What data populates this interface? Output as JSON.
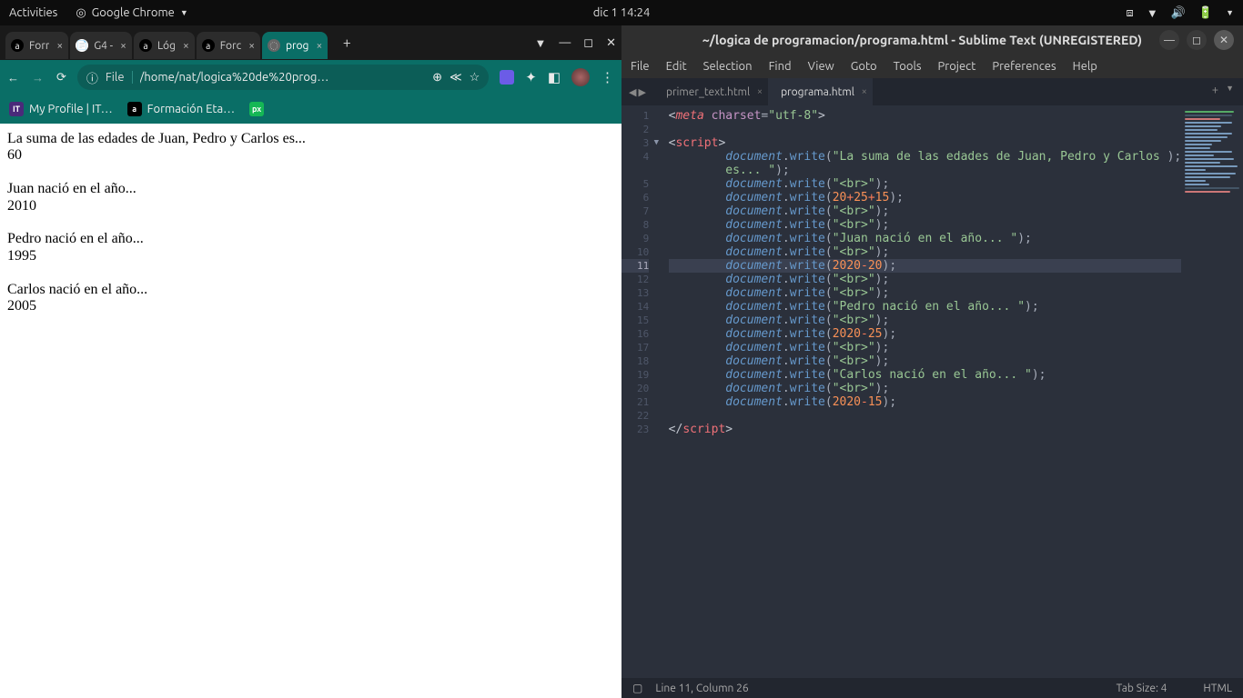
{
  "topbar": {
    "activities": "Activities",
    "app": "Google Chrome",
    "clock": "dic 1  14:24"
  },
  "chrome": {
    "tabs": [
      {
        "icon": "a",
        "iconbg": "#000",
        "label": "Forr"
      },
      {
        "icon": "📄",
        "iconbg": "#fff",
        "label": "G4 -"
      },
      {
        "icon": "a",
        "iconbg": "#000",
        "label": "Lóg"
      },
      {
        "icon": "a",
        "iconbg": "#000",
        "label": "Forc"
      },
      {
        "icon": "◌",
        "iconbg": "#666",
        "label": "prog",
        "active": true
      }
    ],
    "url_scheme": "File",
    "url_path": "/home/nat/logica%20de%20prog…",
    "bookmarks": [
      {
        "icon": "IT",
        "bg": "#4a2a7a",
        "label": "My Profile | IT…"
      },
      {
        "icon": "a",
        "bg": "#000",
        "label": "Formación Eta…"
      },
      {
        "icon": "px",
        "bg": "#15b755",
        "label": ""
      }
    ],
    "page_lines": [
      "La suma de las edades de Juan, Pedro y Carlos es...",
      "60",
      "",
      "Juan nació en el año...",
      "2010",
      "",
      "Pedro nació en el año...",
      "1995",
      "",
      "Carlos nació en el año...",
      "2005"
    ]
  },
  "sublime": {
    "title": "~/logica de programacion/programa.html - Sublime Text (UNREGISTERED)",
    "menu": [
      "File",
      "Edit",
      "Selection",
      "Find",
      "View",
      "Goto",
      "Tools",
      "Project",
      "Preferences",
      "Help"
    ],
    "tabs": [
      {
        "label": "primer_text.html",
        "active": false
      },
      {
        "label": "programa.html",
        "active": true
      }
    ],
    "highlighted_line": 11,
    "lines": [
      {
        "n": 1,
        "type": "meta"
      },
      {
        "n": 2,
        "type": "blank"
      },
      {
        "n": 3,
        "type": "script-open"
      },
      {
        "n": 4,
        "type": "write-str",
        "str": "\"La suma de las edades de Juan, Pedro y Carlos ",
        "indent": 2
      },
      {
        "n": 0,
        "type": "cont-str",
        "str": "es... \""
      },
      {
        "n": 5,
        "type": "write-str",
        "str": "\"<br>\"",
        "indent": 2
      },
      {
        "n": 6,
        "type": "write-expr",
        "expr": [
          [
            "num",
            "20"
          ],
          [
            "op",
            "+"
          ],
          [
            "num",
            "25"
          ],
          [
            "op",
            "+"
          ],
          [
            "num",
            "15"
          ]
        ],
        "indent": 2
      },
      {
        "n": 7,
        "type": "write-str",
        "str": "\"<br>\"",
        "indent": 2
      },
      {
        "n": 8,
        "type": "write-str",
        "str": "\"<br>\"",
        "indent": 2
      },
      {
        "n": 9,
        "type": "write-str",
        "str": "\"Juan nació en el año... \"",
        "indent": 2
      },
      {
        "n": 10,
        "type": "write-str",
        "str": "\"<br>\"",
        "indent": 2
      },
      {
        "n": 11,
        "type": "write-expr",
        "expr": [
          [
            "num",
            "2020"
          ],
          [
            "op",
            "-"
          ],
          [
            "num",
            "20"
          ]
        ],
        "indent": 2
      },
      {
        "n": 12,
        "type": "write-str",
        "str": "\"<br>\"",
        "indent": 2
      },
      {
        "n": 13,
        "type": "write-str",
        "str": "\"<br>\"",
        "indent": 2
      },
      {
        "n": 14,
        "type": "write-str",
        "str": "\"Pedro nació en el año... \"",
        "indent": 2
      },
      {
        "n": 15,
        "type": "write-str",
        "str": "\"<br>\"",
        "indent": 2
      },
      {
        "n": 16,
        "type": "write-expr",
        "expr": [
          [
            "num",
            "2020"
          ],
          [
            "op",
            "-"
          ],
          [
            "num",
            "25"
          ]
        ],
        "indent": 2
      },
      {
        "n": 17,
        "type": "write-str",
        "str": "\"<br>\"",
        "indent": 2
      },
      {
        "n": 18,
        "type": "write-str",
        "str": "\"<br>\"",
        "indent": 2
      },
      {
        "n": 19,
        "type": "write-str",
        "str": "\"Carlos nació en el año... \"",
        "indent": 2
      },
      {
        "n": 20,
        "type": "write-str",
        "str": "\"<br>\"",
        "indent": 2
      },
      {
        "n": 21,
        "type": "write-expr",
        "expr": [
          [
            "num",
            "2020"
          ],
          [
            "op",
            "-"
          ],
          [
            "num",
            "15"
          ]
        ],
        "indent": 2
      },
      {
        "n": 22,
        "type": "blank"
      },
      {
        "n": 23,
        "type": "script-close"
      }
    ],
    "status": {
      "pos": "Line 11, Column 26",
      "tab": "Tab Size: 4",
      "lang": "HTML"
    }
  }
}
